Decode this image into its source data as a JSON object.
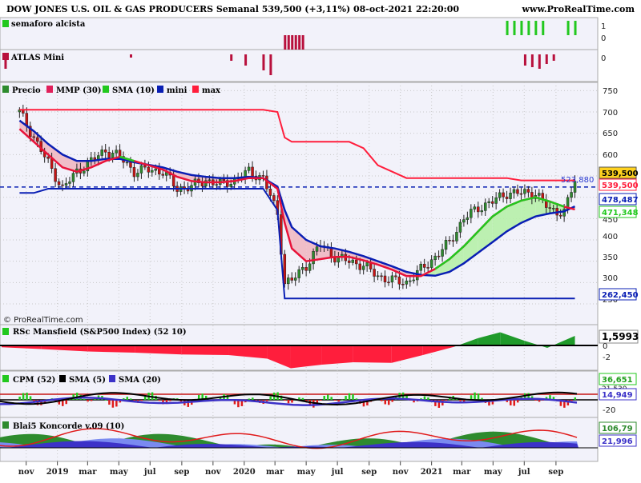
{
  "header": {
    "title": "DOW JONES U.S. OIL & GAS PRODUCERS Semanal 539,500 (+3,11%) 08-oct-2021 22:20:00",
    "site": "www.ProRealTime.com"
  },
  "copyright": "© ProRealTime.com",
  "panels": {
    "semaforo": {
      "label": "semaforo alcista",
      "scale": [
        "1",
        "0"
      ]
    },
    "atlas": {
      "label": "ATLAS Mini",
      "scale": [
        "0"
      ]
    },
    "price": {
      "legend": [
        "Precio",
        "MMP (30)",
        "SMA (10)",
        "mini",
        "max"
      ],
      "y_ticks": [
        "750",
        "700",
        "650",
        "600",
        "550",
        "500",
        "450",
        "400",
        "350",
        "300",
        "250"
      ],
      "boxes": {
        "last": "539,500",
        "max": "539,500",
        "mmp": "478,487",
        "sma": "471,348",
        "mini": "262,450"
      },
      "dashed_label": "523,880"
    },
    "rsc": {
      "label": "RSc Mansfield (S&P500 Index) (52 10)",
      "value": "1,5993",
      "ticks": [
        "0",
        "-2"
      ]
    },
    "cpm": {
      "legend": [
        "CPM (52)",
        "SMA (5)",
        "SMA (20)"
      ],
      "v1": "36,651",
      "v2": "21,530",
      "v3": "14,949",
      "tick": "-20"
    },
    "blai5": {
      "label": "Blai5 Koncorde v.09 (10)",
      "v1": "106,79",
      "v2": "21,996"
    }
  },
  "x_axis": [
    "nov",
    "2019",
    "mar",
    "may",
    "jul",
    "sep",
    "nov",
    "2020",
    "mar",
    "may",
    "jul",
    "sep",
    "nov",
    "2021",
    "mar",
    "may",
    "jul",
    "sep"
  ],
  "colors": {
    "blue": "#0a1fb4",
    "red": "#ff1e3c",
    "green": "#22c81e",
    "up": "#2e8b2e",
    "down": "#d01a1a",
    "grid": "#c8c8c8",
    "panel_bg": "#f2f2fa"
  },
  "chart_data": {
    "type": "line",
    "title": "DOW JONES U.S. OIL & GAS PRODUCERS Semanal 539,500 (+3,11%) 08-oct-2021 22:20:00",
    "x_labels": [
      "nov",
      "2019",
      "mar",
      "may",
      "jul",
      "sep",
      "nov",
      "2020",
      "mar",
      "may",
      "jul",
      "sep",
      "nov",
      "2021",
      "mar",
      "may",
      "jul",
      "sep"
    ],
    "ylim": [
      250,
      760
    ],
    "x": [
      "2018-10-19",
      "2018-11-16",
      "2018-12-14",
      "2019-01-11",
      "2019-02-08",
      "2019-03-08",
      "2019-04-05",
      "2019-05-03",
      "2019-05-31",
      "2019-06-28",
      "2019-07-26",
      "2019-08-23",
      "2019-09-20",
      "2019-10-18",
      "2019-11-15",
      "2019-12-13",
      "2020-01-10",
      "2020-02-07",
      "2020-03-06",
      "2020-03-20",
      "2020-04-03",
      "2020-05-01",
      "2020-05-29",
      "2020-06-26",
      "2020-07-24",
      "2020-08-21",
      "2020-09-18",
      "2020-10-16",
      "2020-11-13",
      "2020-12-11",
      "2021-01-08",
      "2021-02-05",
      "2021-03-05",
      "2021-04-02",
      "2021-04-30",
      "2021-05-28",
      "2021-06-25",
      "2021-07-23",
      "2021-08-20",
      "2021-09-17",
      "2021-10-08"
    ],
    "series": [
      {
        "name": "Precio",
        "values": [
          700,
          640,
          580,
          520,
          560,
          585,
          610,
          595,
          560,
          565,
          560,
          520,
          525,
          540,
          530,
          540,
          560,
          545,
          460,
          300,
          305,
          340,
          390,
          360,
          350,
          340,
          315,
          305,
          300,
          330,
          360,
          395,
          450,
          475,
          490,
          510,
          510,
          510,
          470,
          465,
          539.5
        ]
      },
      {
        "name": "MMP (30)",
        "values": [
          680,
          655,
          625,
          600,
          585,
          585,
          590,
          590,
          582,
          576,
          570,
          560,
          552,
          548,
          545,
          545,
          548,
          545,
          525,
          470,
          430,
          400,
          385,
          380,
          372,
          362,
          350,
          338,
          325,
          318,
          316,
          325,
          345,
          370,
          395,
          420,
          440,
          455,
          462,
          467,
          478.487
        ]
      },
      {
        "name": "SMA (10)",
        "values": [
          660,
          630,
          600,
          570,
          560,
          570,
          585,
          595,
          585,
          575,
          565,
          548,
          538,
          535,
          535,
          538,
          545,
          545,
          520,
          440,
          380,
          350,
          355,
          360,
          360,
          352,
          342,
          330,
          315,
          315,
          332,
          355,
          385,
          420,
          455,
          478,
          492,
          500,
          490,
          478,
          471.348
        ]
      },
      {
        "name": "mini",
        "values": [
          510,
          510,
          520,
          520,
          520,
          520,
          520,
          520,
          520,
          520,
          520,
          520,
          520,
          520,
          520,
          520,
          520,
          520,
          470,
          262.45,
          262.45,
          262.45,
          262.45,
          262.45,
          262.45,
          262.45,
          262.45,
          262.45,
          262.45,
          262.45,
          262.45,
          262.45,
          262.45,
          262.45,
          262.45,
          262.45,
          262.45,
          262.45,
          262.45,
          262.45,
          262.45
        ]
      },
      {
        "name": "max",
        "values": [
          705,
          705,
          705,
          705,
          705,
          705,
          705,
          705,
          705,
          705,
          705,
          705,
          705,
          705,
          705,
          705,
          705,
          705,
          700,
          640,
          630,
          630,
          630,
          630,
          630,
          615,
          575,
          560,
          545,
          545,
          545,
          545,
          545,
          545,
          545,
          545,
          539.5,
          539.5,
          539.5,
          539.5,
          539.5
        ]
      }
    ]
  }
}
